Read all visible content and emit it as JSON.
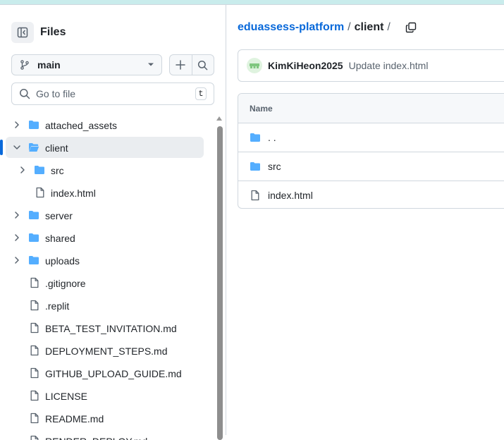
{
  "sidebar": {
    "title": "Files",
    "branch": "main",
    "search_placeholder": "Go to file",
    "search_shortcut": "t",
    "tree": [
      {
        "label": "attached_assets",
        "type": "folder",
        "depth": 0,
        "chevron": "right"
      },
      {
        "label": "client",
        "type": "folder-open",
        "depth": 0,
        "chevron": "down",
        "selected": true
      },
      {
        "label": "src",
        "type": "folder",
        "depth": 1,
        "chevron": "right"
      },
      {
        "label": "index.html",
        "type": "file",
        "depth": 1
      },
      {
        "label": "server",
        "type": "folder",
        "depth": 0,
        "chevron": "right"
      },
      {
        "label": "shared",
        "type": "folder",
        "depth": 0,
        "chevron": "right"
      },
      {
        "label": "uploads",
        "type": "folder",
        "depth": 0,
        "chevron": "right"
      },
      {
        "label": ".gitignore",
        "type": "file",
        "depth": 0
      },
      {
        "label": ".replit",
        "type": "file",
        "depth": 0
      },
      {
        "label": "BETA_TEST_INVITATION.md",
        "type": "file",
        "depth": 0
      },
      {
        "label": "DEPLOYMENT_STEPS.md",
        "type": "file",
        "depth": 0
      },
      {
        "label": "GITHUB_UPLOAD_GUIDE.md",
        "type": "file",
        "depth": 0
      },
      {
        "label": "LICENSE",
        "type": "file",
        "depth": 0
      },
      {
        "label": "README.md",
        "type": "file",
        "depth": 0
      },
      {
        "label": "RENDER_DEPLOY.md",
        "type": "file",
        "depth": 0
      }
    ]
  },
  "breadcrumb": {
    "repo": "eduassess-platform",
    "separator": "/",
    "current": "client",
    "trailing": "/"
  },
  "commit": {
    "author": "KimKiHeon2025",
    "message": "Update index.html"
  },
  "table": {
    "header": "Name",
    "rows": [
      {
        "name": ". .",
        "type": "folder"
      },
      {
        "name": "src",
        "type": "folder"
      },
      {
        "name": "index.html",
        "type": "file"
      }
    ]
  },
  "colors": {
    "accent": "#0969da",
    "folder": "#54aeff",
    "border": "#d0d7de",
    "muted": "#59636e"
  }
}
